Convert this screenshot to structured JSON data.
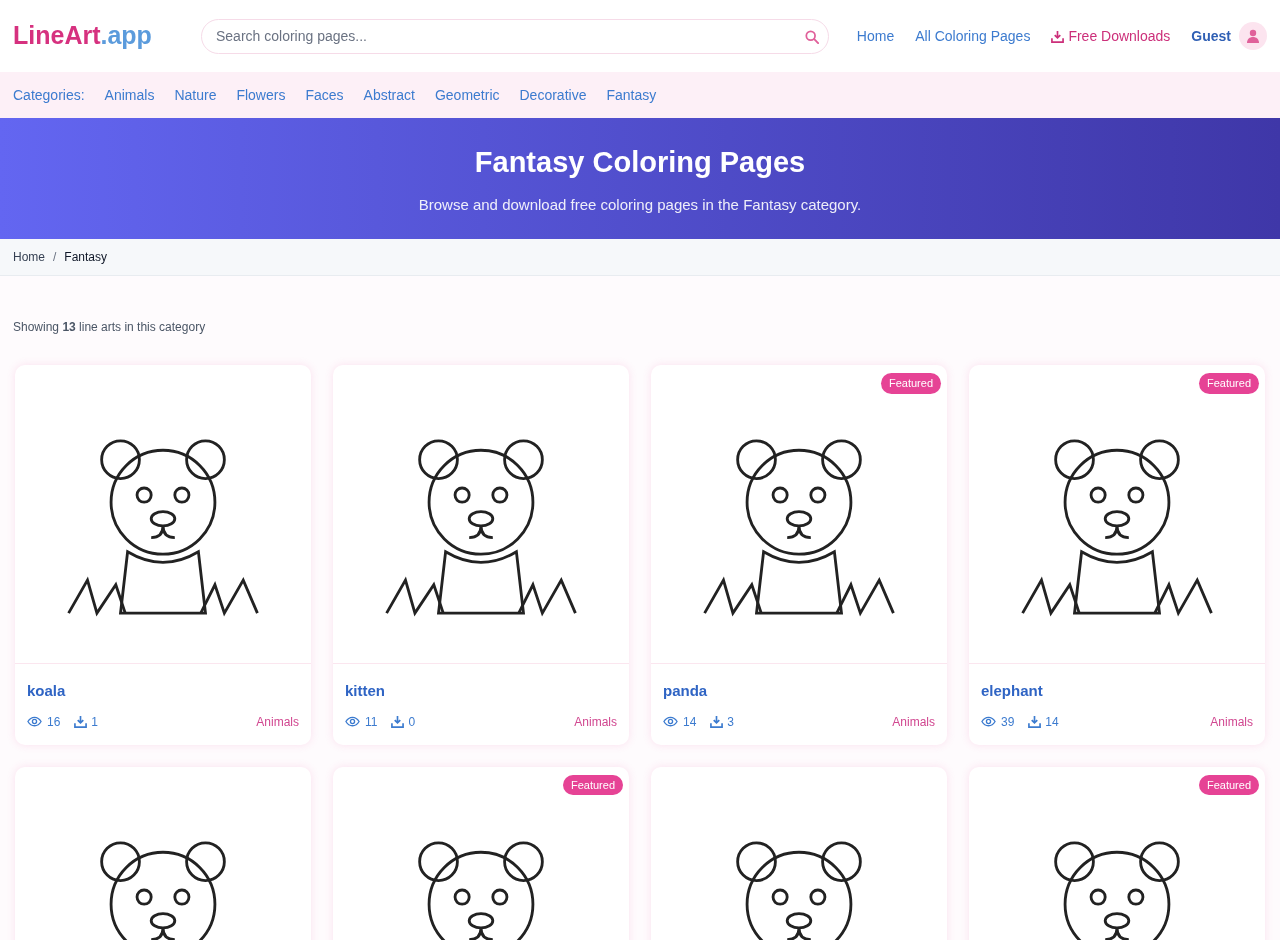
{
  "logo": {
    "part_1": "LineArt",
    "part_2": ".app"
  },
  "search": {
    "placeholder": "Search coloring pages..."
  },
  "nav": [
    {
      "label": "Home",
      "kind": "link"
    },
    {
      "label": "All Coloring Pages",
      "kind": "link"
    },
    {
      "label": "Free Downloads",
      "kind": "download"
    },
    {
      "label": "Guest",
      "kind": "user"
    }
  ],
  "categories": {
    "label": "Categories:",
    "items": [
      "Animals",
      "Nature",
      "Flowers",
      "Faces",
      "Abstract",
      "Geometric",
      "Decorative",
      "Fantasy"
    ]
  },
  "hero": {
    "title": "Fantasy Coloring Pages",
    "subtitle": "Browse and download free coloring pages in the Fantasy category."
  },
  "breadcrumb": {
    "home": "Home",
    "separator": "/",
    "current": "Fantasy"
  },
  "summary": "Showing **13** line arts in this category",
  "cards": [
    {
      "kind": "full",
      "title": "koala",
      "views": "16",
      "downloads": "1",
      "category": "Animals"
    },
    {
      "kind": "full",
      "title": "kitten",
      "views": "11",
      "downloads": "0",
      "category": "Animals"
    },
    {
      "kind": "full",
      "title": "panda",
      "views": "14",
      "downloads": "3",
      "category": "Animals",
      "badge": "Featured"
    },
    {
      "kind": "full",
      "title": "elephant",
      "views": "39",
      "downloads": "14",
      "category": "Animals",
      "badge": "Featured"
    },
    {
      "kind": "image_only"
    },
    {
      "kind": "image_only",
      "badge": "Featured"
    },
    {
      "kind": "image_only"
    },
    {
      "kind": "image_only",
      "badge": "Featured"
    }
  ]
}
